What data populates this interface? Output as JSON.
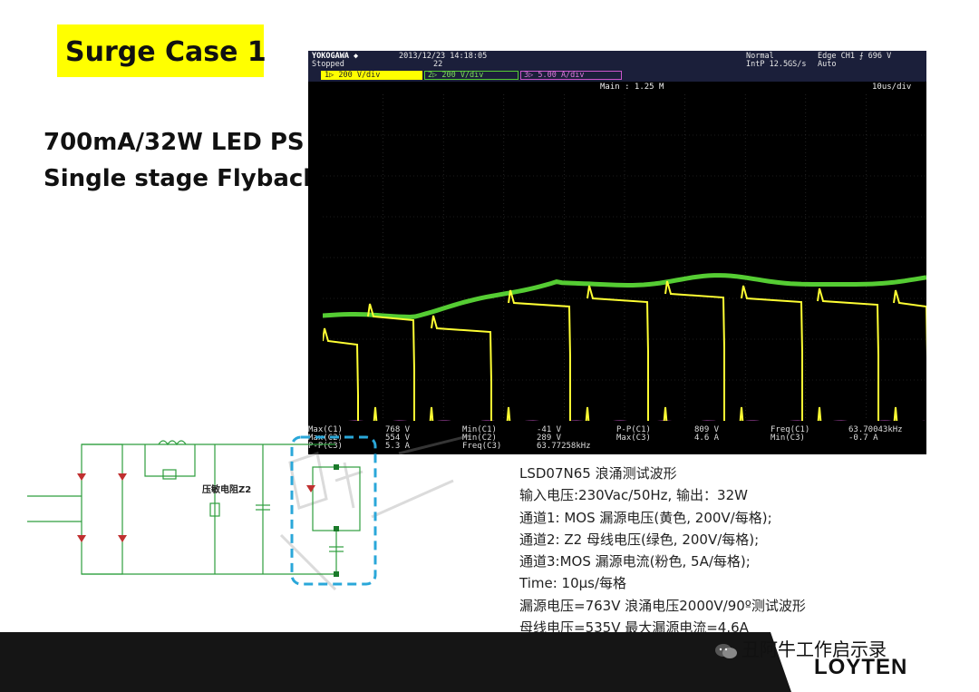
{
  "slide": {
    "title": "Surge Case 1",
    "subtitle_line1": "700mA/32W LED PS",
    "subtitle_line2": "Single stage Flyback"
  },
  "scope": {
    "brand": "YOKOGAWA ◆",
    "status": "Stopped",
    "datetime": "2013/12/23 14:18:05",
    "count": "22",
    "mode": "Normal",
    "sample": "IntP 12.5GS/s",
    "trigger": "Edge CH1 ⨍ 696 V",
    "trigger_mode": "Auto",
    "ch1_label": "1▷ 200 V/div",
    "ch2_label": "2▷ 200 V/div",
    "ch3_label": "3▷ 5.00 A/div",
    "main_label": "Main : 1.25 M",
    "timebase": "10us/div",
    "meas": {
      "max_c1_label": "Max(C1)",
      "max_c1": "768 V",
      "max_c2_label": "Max(C2)",
      "max_c2": "554 V",
      "pp_c3_label": "P-P(C3)",
      "pp_c3": "5.3 A",
      "min_c1_label": "Min(C1)",
      "min_c1": "-41 V",
      "min_c2_label": "Min(C2)",
      "min_c2": "289 V",
      "freq_c3_label": "Freq(C3)",
      "freq_c3": "63.77258kHz",
      "ppc1_label": "P-P(C1)",
      "ppc1": "809 V",
      "maxc3_label": "Max(C3)",
      "maxc3": "4.6 A",
      "freqc1_label": "Freq(C1)",
      "freqc1": "63.70043kHz",
      "minc3_label": "Min(C3)",
      "minc3": "-0.7 A"
    }
  },
  "schematic": {
    "varistor_label": "压敏电阻Z2"
  },
  "notes": [
    "LSD07N65 浪涌测试波形",
    "输入电压:230Vac/50Hz, 输出：32W",
    "通道1: MOS 漏源电压(黄色, 200V/每格);",
    "通道2: Z2 母线电压(绿色, 200V/每格);",
    "通道3:MOS 漏源电流(粉色, 5A/每格);",
    "Time: 10μs/每格",
    "漏源电压=763V  浪涌电压2000V/90º测试波形",
    "母线电压=535V  最大漏源电流=4.6A"
  ],
  "footer": {
    "wechat_name": "丑阿牛工作启示录",
    "brand": "LOYTEN"
  },
  "colors": {
    "title_bg": "#ffff00",
    "ch1": "#ffff33",
    "ch2": "#55cc33",
    "ch3": "#cc55cc",
    "schematic": "#2e9e3e",
    "highlight": "#2aa7d9"
  }
}
